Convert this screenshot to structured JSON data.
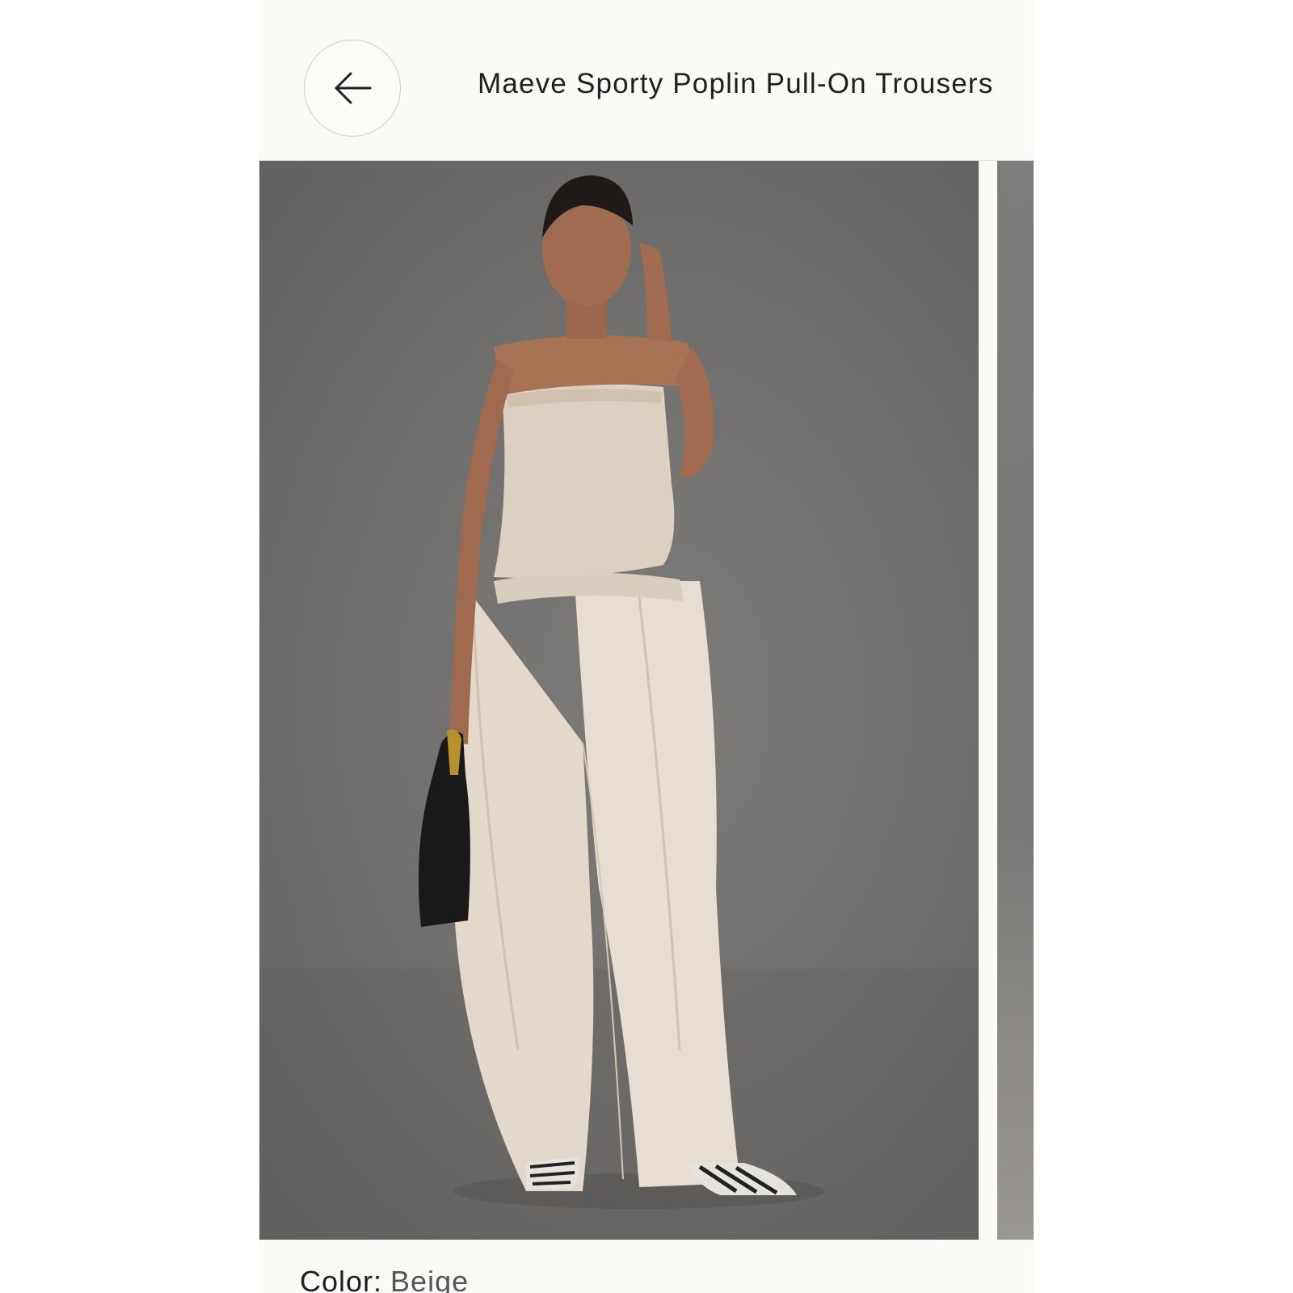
{
  "header": {
    "back_icon": "arrow-left-icon",
    "title": "Maeve Sporty Poplin Pull-On Trousers"
  },
  "gallery": {
    "image_description": "Model in beige strapless top and beige wide-leg pull-on trousers holding a black bag, grey studio background",
    "background_color": "#727170",
    "garment_color": "#e2d7c9"
  },
  "product": {
    "color_label": "Color:",
    "color_value": "Beige"
  }
}
